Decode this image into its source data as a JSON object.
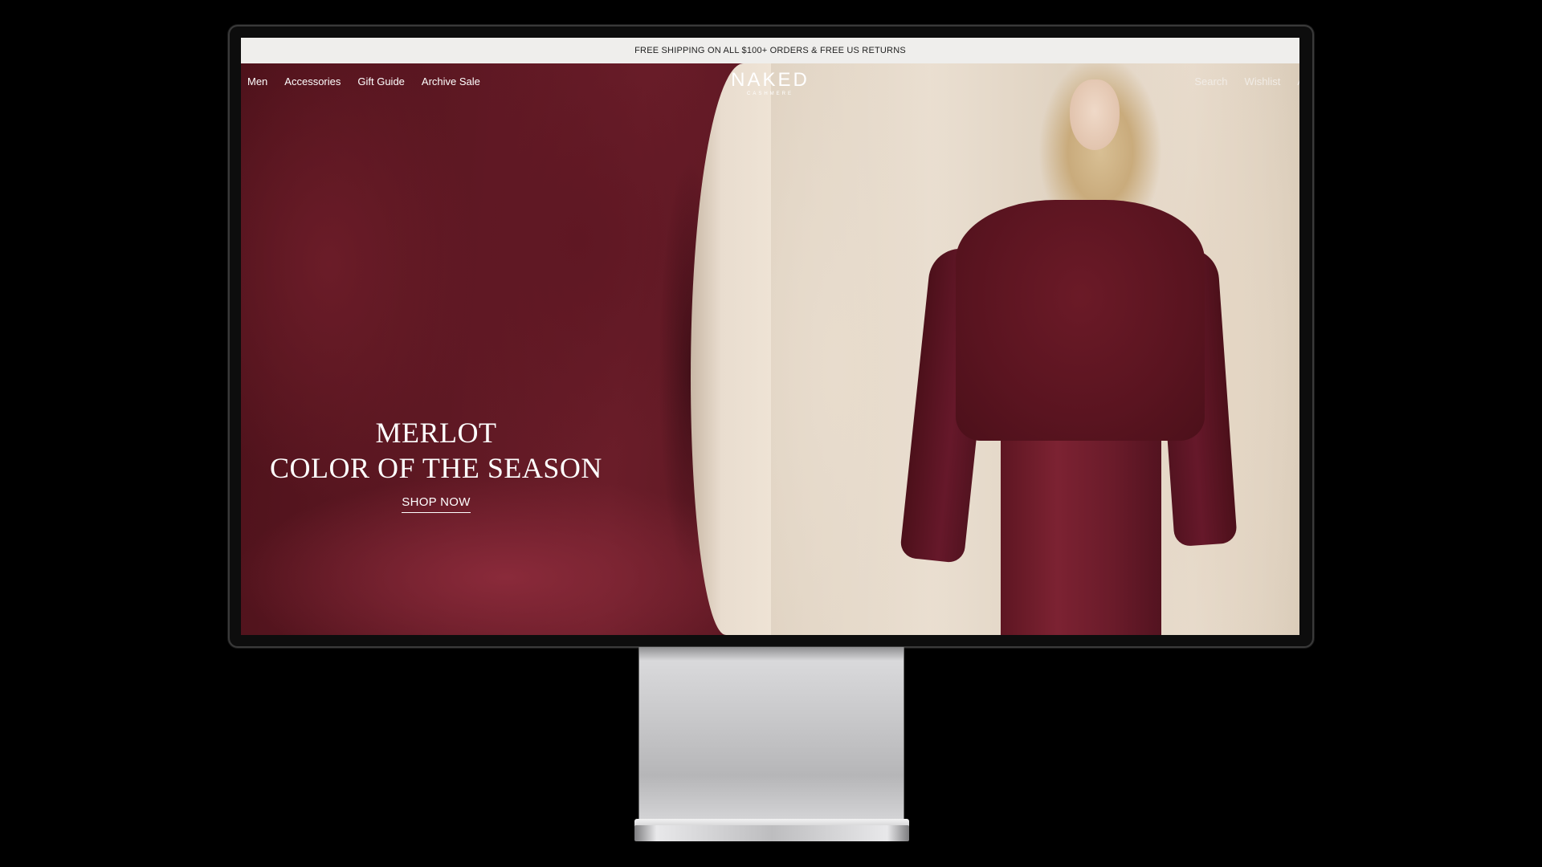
{
  "promo": {
    "text": "FREE SHIPPING ON ALL $100+ ORDERS & FREE US RETURNS"
  },
  "nav": {
    "left": [
      "Men",
      "Accessories",
      "Gift Guide",
      "Archive Sale"
    ],
    "right": [
      "Search",
      "Wishlist",
      "A"
    ]
  },
  "logo": {
    "main": "NAKED",
    "sub": "CASHMERE"
  },
  "hero": {
    "title_line_1": "MERLOT",
    "title_line_2": "COLOR OF THE SEASON",
    "cta": "SHOP NOW"
  },
  "colors": {
    "merlot": "#5e1823",
    "cream": "#e8dccd",
    "promo_bg": "#efeeec"
  }
}
